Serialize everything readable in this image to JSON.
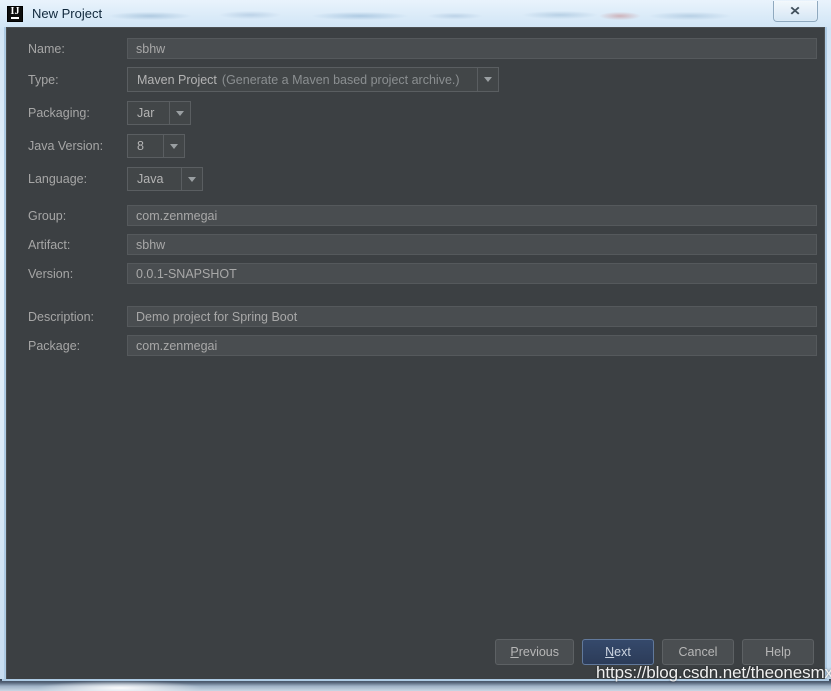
{
  "window": {
    "title": "New Project",
    "app_icon": "intellij-idea-icon",
    "close_label": "✕"
  },
  "form": {
    "fields": [
      {
        "id": "name",
        "label": "Name:",
        "kind": "text",
        "value": "sbhw"
      },
      {
        "id": "type",
        "label": "Type:",
        "kind": "combo",
        "value": "Maven Project",
        "hint": "(Generate a Maven based project archive.)"
      },
      {
        "id": "packaging",
        "label": "Packaging:",
        "kind": "combo",
        "value": "Jar"
      },
      {
        "id": "java_version",
        "label": "Java Version:",
        "kind": "combo",
        "value": "8"
      },
      {
        "id": "language",
        "label": "Language:",
        "kind": "combo",
        "value": "Java"
      },
      {
        "id": "group",
        "label": "Group:",
        "kind": "text",
        "value": "com.zenmegai"
      },
      {
        "id": "artifact",
        "label": "Artifact:",
        "kind": "text",
        "value": "sbhw"
      },
      {
        "id": "version",
        "label": "Version:",
        "kind": "text",
        "value": "0.0.1-SNAPSHOT"
      },
      {
        "id": "description",
        "label": "Description:",
        "kind": "text",
        "value": "Demo project for Spring Boot"
      },
      {
        "id": "package",
        "label": "Package:",
        "kind": "text",
        "value": "com.zenmegai"
      }
    ]
  },
  "buttons": {
    "previous": {
      "mnemonic": "P",
      "rest": "revious"
    },
    "next": {
      "mnemonic": "N",
      "rest": "ext"
    },
    "cancel": "Cancel",
    "help": "Help"
  },
  "watermark": "https://blog.csdn.net/theonesmx",
  "colors": {
    "dialog_bg": "#3c4043",
    "field_bg": "#494d50",
    "label_text": "#a6a6a6",
    "value_text": "#a8a8a8",
    "hint_text": "#8b8f91",
    "default_button_bg": "#35496b",
    "default_button_border": "#61799c",
    "frame_border": "#aecbe4"
  }
}
